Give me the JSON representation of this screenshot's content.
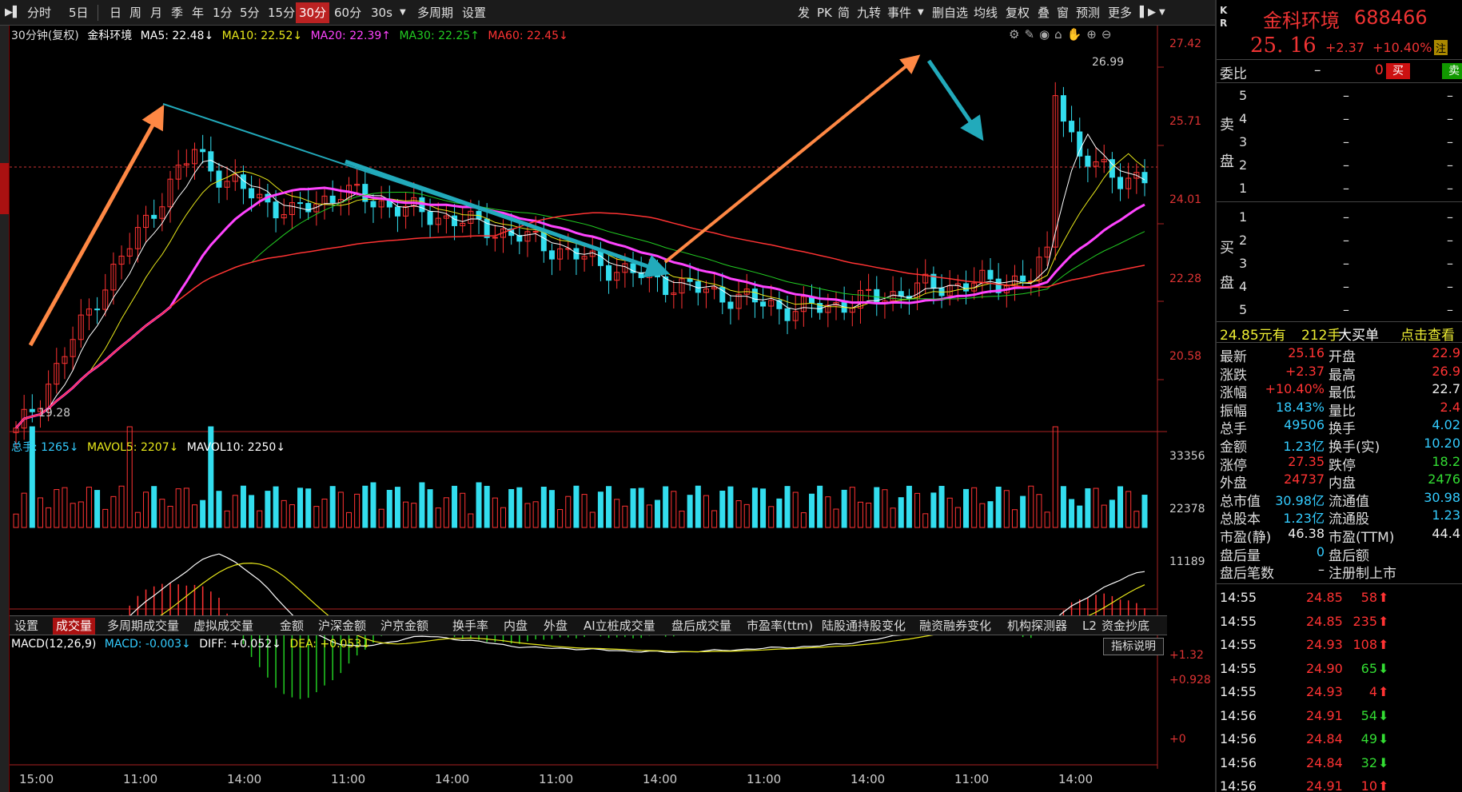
{
  "toolbar": {
    "left_items": [
      "分时",
      "5日",
      "日",
      "周",
      "月",
      "季",
      "年",
      "1分",
      "5分",
      "15分",
      "30分",
      "60分",
      "30s",
      "多周期",
      "设置"
    ],
    "active_item": "30分",
    "right_items": [
      "发",
      "PK",
      "简",
      "九转",
      "事件",
      "删自选",
      "均线",
      "复权",
      "叠",
      "窗",
      "预测",
      "更多"
    ]
  },
  "chart": {
    "title_left": "30分钟(复权)",
    "stock_name": "金科环境",
    "ma": [
      {
        "label": "MA5: 22.48↓",
        "color": "#ffffff"
      },
      {
        "label": "MA10: 22.52↓",
        "color": "#e8e81a"
      },
      {
        "label": "MA20: 22.39↑",
        "color": "#ff44ff"
      },
      {
        "label": "MA30: 22.25↑",
        "color": "#22cc22"
      },
      {
        "label": "MA60: 22.45↓",
        "color": "#ff3333"
      }
    ],
    "price_axis": [
      "27.42",
      "25.71",
      "24.01",
      "22.28",
      "20.58"
    ],
    "high_label": "26.99",
    "low_label": "19.28",
    "volume_legend": [
      {
        "label": "总手: 1265↓",
        "color": "#33ccff"
      },
      {
        "label": "MAVOL5: 2207↓",
        "color": "#e8e81a"
      },
      {
        "label": "MAVOL10: 2250↓",
        "color": "#ffffff"
      }
    ],
    "volume_axis": [
      "33356",
      "22378",
      "11189"
    ],
    "macd_legend": [
      {
        "label": "MACD(12,26,9)",
        "color": "#ffffff"
      },
      {
        "label": "MACD: -0.003↓",
        "color": "#33ccff"
      },
      {
        "label": "DIFF: +0.052↓",
        "color": "#ffffff"
      },
      {
        "label": "DEA: +0.053↓",
        "color": "#e8e81a"
      }
    ],
    "macd_axis": [
      "+1.32",
      "+0.928",
      "+0"
    ],
    "time_axis": [
      "15:00",
      "11:00",
      "14:00",
      "11:00",
      "14:00",
      "11:00",
      "14:00",
      "11:00",
      "14:00",
      "11:00",
      "14:00"
    ],
    "indicator_button": "指标说明"
  },
  "tabs": [
    "设置",
    "成交量",
    "多周期成交量",
    "虚拟成交量",
    "金额",
    "沪深金额",
    "沪京金额",
    "换手率",
    "内盘",
    "外盘",
    "AI立桩成交量",
    "盘后成交量",
    "市盈率(ttm)",
    "陆股通持股变化",
    "融资融券变化",
    "机构探测器",
    "L2",
    "资金抄底"
  ],
  "active_tab": "成交量",
  "panel": {
    "kr_top": "K",
    "kr_bottom": "R",
    "name": "金科环境",
    "code": "688466",
    "price": "25. 16",
    "change": "+2.37",
    "change_pct": "+10.40%",
    "note": "注",
    "weibi_label": "委比",
    "weibi_dash": "–",
    "weibi_value": "0",
    "buy_btn": "买",
    "sell_btn": "卖",
    "sell_label": [
      "卖",
      "盘"
    ],
    "buy_label": [
      "买",
      "盘"
    ],
    "sell_levels": [
      "5",
      "4",
      "3",
      "2",
      "1"
    ],
    "buy_levels": [
      "1",
      "2",
      "3",
      "4",
      "5"
    ],
    "level_dash": "–",
    "big_order": {
      "price": "24.85元有",
      "vol": "212手",
      "label": "大买单",
      "link": "点击查看"
    },
    "info": [
      {
        "l1": "最新",
        "v1": "25.16",
        "c1": "red",
        "l2": "开盘",
        "v2": "22.9",
        "c2": "red"
      },
      {
        "l1": "涨跌",
        "v1": "+2.37",
        "c1": "red",
        "l2": "最高",
        "v2": "26.9",
        "c2": "red"
      },
      {
        "l1": "涨幅",
        "v1": "+10.40%",
        "c1": "red",
        "l2": "最低",
        "v2": "22.7",
        "c2": "white"
      },
      {
        "l1": "振幅",
        "v1": "18.43%",
        "c1": "cyan",
        "l2": "量比",
        "v2": "2.4",
        "c2": "red"
      },
      {
        "l1": "总手",
        "v1": "49506",
        "c1": "cyan",
        "l2": "换手",
        "v2": "4.02",
        "c2": "cyan"
      },
      {
        "l1": "金额",
        "v1": "1.23亿",
        "c1": "cyan",
        "l2": "换手(实)",
        "v2": "10.20",
        "c2": "cyan"
      },
      {
        "l1": "涨停",
        "v1": "27.35",
        "c1": "red",
        "l2": "跌停",
        "v2": "18.2",
        "c2": "green"
      },
      {
        "l1": "外盘",
        "v1": "24737",
        "c1": "red",
        "l2": "内盘",
        "v2": "2476",
        "c2": "green"
      },
      {
        "l1": "总市值",
        "v1": "30.98亿",
        "c1": "cyan",
        "l2": "流通值",
        "v2": "30.98",
        "c2": "cyan"
      },
      {
        "l1": "总股本",
        "v1": "1.23亿",
        "c1": "cyan",
        "l2": "流通股",
        "v2": "1.23",
        "c2": "cyan"
      },
      {
        "l1": "市盈(静)",
        "v1": "46.38",
        "c1": "white",
        "l2": "市盈(TTM)",
        "v2": "44.4",
        "c2": "white"
      },
      {
        "l1": "盘后量",
        "v1": "0",
        "c1": "cyan",
        "l2": "盘后额",
        "v2": "",
        "c2": "white"
      },
      {
        "l1": "盘后笔数",
        "v1": "–",
        "c1": "white",
        "l2": "注册制上市",
        "v2": "",
        "c2": "white"
      }
    ],
    "ticks": [
      {
        "time": "14:55",
        "price": "24.85",
        "vol": "58",
        "dir": "up"
      },
      {
        "time": "14:55",
        "price": "24.85",
        "vol": "235",
        "dir": "up"
      },
      {
        "time": "14:55",
        "price": "24.93",
        "vol": "108",
        "dir": "up"
      },
      {
        "time": "14:55",
        "price": "24.90",
        "vol": "65",
        "dir": "down"
      },
      {
        "time": "14:55",
        "price": "24.93",
        "vol": "4",
        "dir": "up"
      },
      {
        "time": "14:56",
        "price": "24.91",
        "vol": "54",
        "dir": "down"
      },
      {
        "time": "14:56",
        "price": "24.84",
        "vol": "49",
        "dir": "down"
      },
      {
        "time": "14:56",
        "price": "24.84",
        "vol": "32",
        "dir": "down"
      },
      {
        "time": "14:56",
        "price": "24.91",
        "vol": "10",
        "dir": "up"
      }
    ]
  }
}
